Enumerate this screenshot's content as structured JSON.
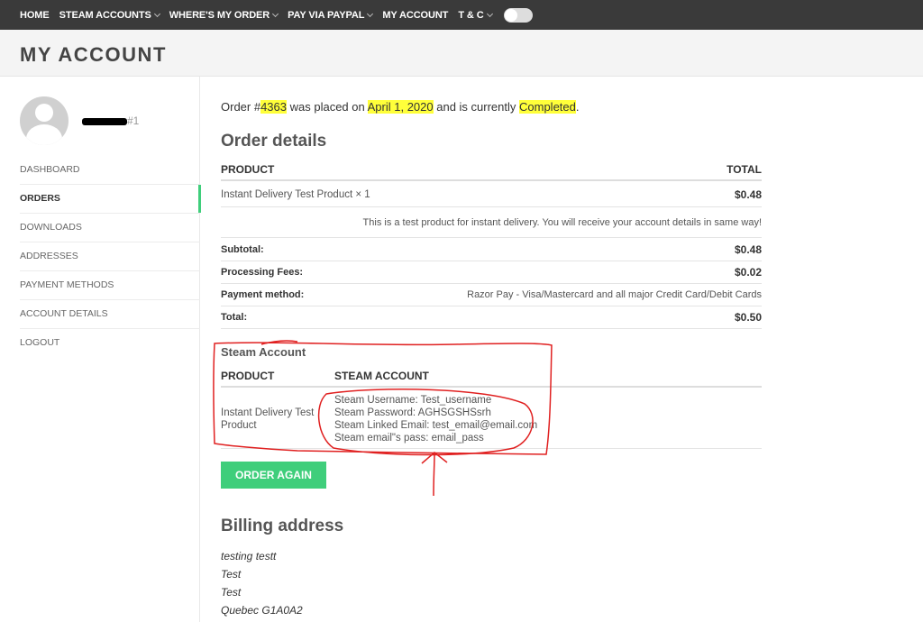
{
  "nav": {
    "items": [
      {
        "label": "HOME",
        "chevron": false
      },
      {
        "label": "STEAM ACCOUNTS",
        "chevron": true
      },
      {
        "label": "WHERE'S MY ORDER",
        "chevron": true
      },
      {
        "label": "PAY VIA PAYPAL",
        "chevron": true
      },
      {
        "label": "MY ACCOUNT",
        "chevron": false
      },
      {
        "label": "T & C",
        "chevron": true
      }
    ]
  },
  "page": {
    "title": "MY ACCOUNT"
  },
  "user": {
    "suffix": "#1"
  },
  "sidebar": {
    "items": [
      "DASHBOARD",
      "ORDERS",
      "DOWNLOADS",
      "ADDRESSES",
      "PAYMENT METHODS",
      "ACCOUNT DETAILS",
      "LOGOUT"
    ],
    "active_index": 1
  },
  "order": {
    "notice_prefix": "Order #",
    "number": "4363",
    "notice_mid": " was placed on ",
    "date": "April 1, 2020",
    "notice_mid2": " and is currently ",
    "status": "Completed",
    "notice_end": "."
  },
  "order_details": {
    "heading": "Order details",
    "col_product": "PRODUCT",
    "col_total": "TOTAL",
    "item_name": "Instant Delivery Test Product × 1",
    "item_total": "$0.48",
    "item_note": "This is a test product for instant delivery. You will receive your account details in same way!",
    "subtotal_label": "Subtotal:",
    "subtotal": "$0.48",
    "fees_label": "Processing Fees:",
    "fees": "$0.02",
    "payment_label": "Payment method:",
    "payment": "Razor Pay - Visa/Mastercard and all major Credit Card/Debit Cards",
    "total_label": "Total:",
    "total": "$0.50"
  },
  "steam": {
    "heading": "Steam Account",
    "col_product": "PRODUCT",
    "col_account": "STEAM ACCOUNT",
    "product": "Instant Delivery Test Product",
    "username": "Steam Username: Test_username",
    "password": "Steam Password: AGHSGSHSsrh",
    "email": "Steam Linked Email: test_email@email.com",
    "email_pass": "Steam email\"s pass: email_pass"
  },
  "actions": {
    "order_again": "ORDER AGAIN"
  },
  "billing": {
    "heading": "Billing address",
    "lines": [
      "testing testt",
      "Test",
      "Test",
      "Quebec G1A0A2"
    ]
  },
  "colors": {
    "accent": "#3fce7b",
    "highlight": "#ffff3a",
    "nav_bg": "#3a3a3a",
    "annotation": "#e02020"
  }
}
